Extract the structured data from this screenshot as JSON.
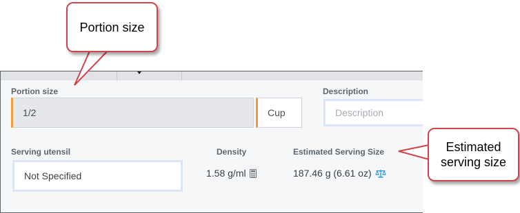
{
  "callouts": {
    "portion": "Portion size",
    "estimated": "Estimated serving size"
  },
  "form": {
    "portion_size_label": "Portion size",
    "portion_value": "1/2",
    "unit": "Cup",
    "description_label": "Description",
    "description_placeholder": "Description",
    "serving_utensil_label": "Serving utensil",
    "serving_utensil_value": "Not Specified",
    "density_label": "Density",
    "density_value": "1.58 g/ml",
    "estimated_label": "Estimated Serving Size",
    "estimated_value": "187.46 g (6.61 oz)"
  },
  "icons": {
    "density": "calculator-icon",
    "estimated": "scale-icon"
  },
  "colors": {
    "accent_orange": "#f29b3a",
    "link_blue": "#2b9ad6",
    "callout_border": "#d0434a"
  }
}
